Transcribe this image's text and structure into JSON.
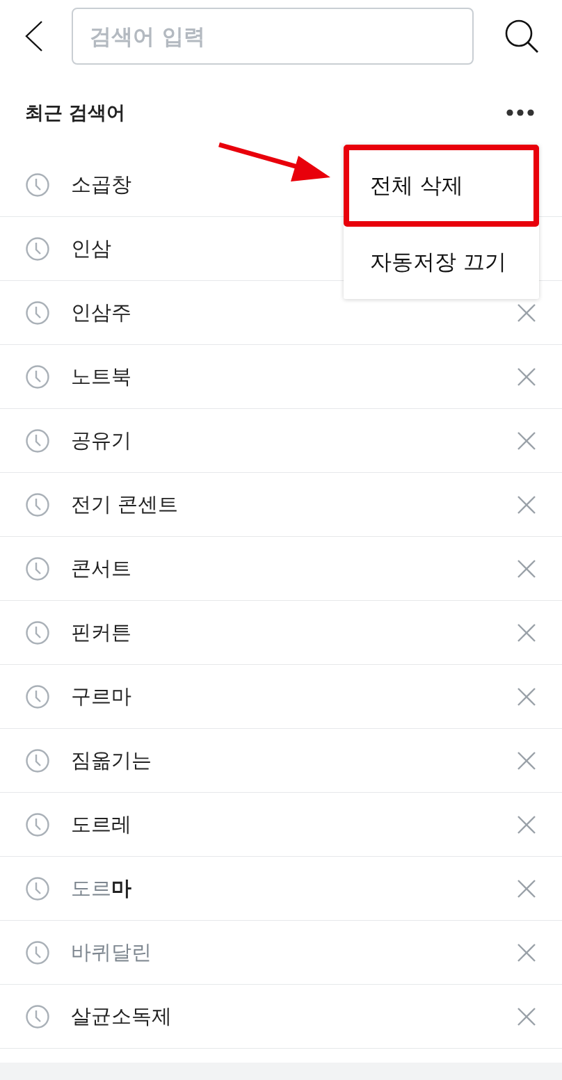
{
  "top_bar": {
    "search": {
      "placeholder": "검색어 입력"
    }
  },
  "recent": {
    "title": "최근 검색어",
    "rows": [
      {
        "text": "소곱창",
        "muted": false
      },
      {
        "text": "인삼",
        "muted": false
      },
      {
        "text": "인삼주",
        "muted": false
      },
      {
        "text": "노트북",
        "muted": false
      },
      {
        "text": "공유기",
        "muted": false
      },
      {
        "text": "전기 콘센트",
        "muted": false
      },
      {
        "text": "콘서트",
        "muted": false
      },
      {
        "text": "핀커튼",
        "muted": false
      },
      {
        "text": "구르마",
        "muted": false
      },
      {
        "text": "짐옮기는",
        "muted": false
      },
      {
        "text": "도르레",
        "muted": false
      },
      {
        "text": "도르**마**",
        "muted": true
      },
      {
        "text": "바퀴달린",
        "muted": true
      },
      {
        "text": "살균소독제",
        "muted": false
      }
    ]
  },
  "menu": {
    "items": [
      {
        "label": "전체 삭제",
        "annotated": true
      },
      {
        "label": "자동저장 끄기",
        "annotated": false
      }
    ]
  }
}
